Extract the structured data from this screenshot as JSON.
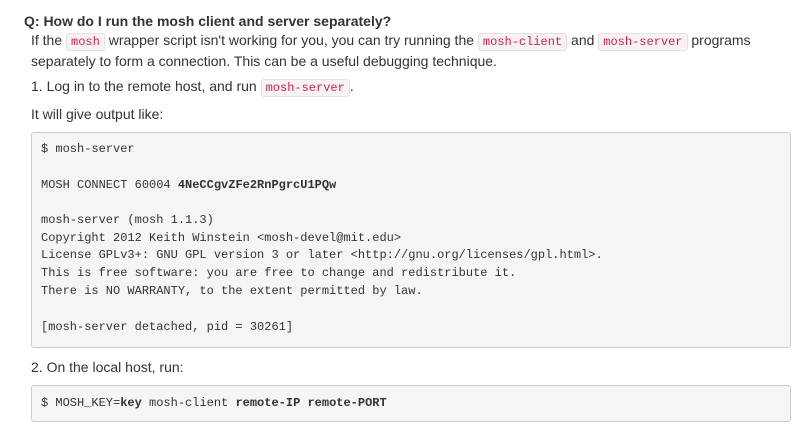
{
  "question": "Q: How do I run the mosh client and server separately?",
  "intro": {
    "t1": "If the ",
    "c1": "mosh",
    "t2": " wrapper script isn't working for you, you can try running the ",
    "c2": "mosh-client",
    "t3": " and ",
    "c3": "mosh-server",
    "t4": " programs separately to form a connection. This can be a useful debugging technique."
  },
  "step1": {
    "text": "1. Log in to the remote host, and run ",
    "code": "mosh-server",
    "end": "."
  },
  "output_label": "It will give output like:",
  "server_output": {
    "line1": "$ mosh-server",
    "line2_prefix": "MOSH CONNECT 60004 ",
    "line2_key": "4NeCCgvZFe2RnPgrcU1PQw",
    "line3": "mosh-server (mosh 1.1.3)",
    "line4": "Copyright 2012 Keith Winstein <mosh-devel@mit.edu>",
    "line5": "License GPLv3+: GNU GPL version 3 or later <http://gnu.org/licenses/gpl.html>.",
    "line6": "This is free software: you are free to change and redistribute it.",
    "line7": "There is NO WARRANTY, to the extent permitted by law.",
    "line8": "[mosh-server detached, pid = 30261]"
  },
  "step2": "2. On the local host, run:",
  "client_command": {
    "prefix": "$ MOSH_KEY=",
    "key": "key",
    "middle": " mosh-client ",
    "ip": "remote-IP",
    "space": " ",
    "port": "remote-PORT"
  }
}
